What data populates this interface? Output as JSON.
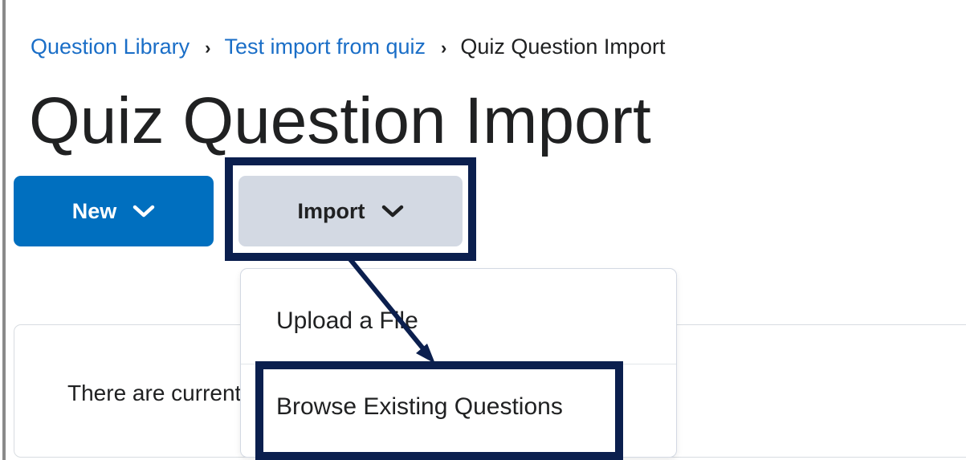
{
  "breadcrumb": {
    "items": [
      {
        "label": "Question Library"
      },
      {
        "label": "Test import from quiz"
      }
    ],
    "current": "Quiz Question Import",
    "separator": "›"
  },
  "page": {
    "title": "Quiz Question Import"
  },
  "toolbar": {
    "new_label": "New",
    "import_label": "Import"
  },
  "import_menu": {
    "items": [
      {
        "label": "Upload a File"
      },
      {
        "label": "Browse Existing Questions"
      }
    ]
  },
  "content": {
    "empty_message": "There are currently no questions defined in this section."
  },
  "colors": {
    "link": "#1a6ec7",
    "primary_button": "#006fbf",
    "secondary_button": "#d3d9e3",
    "annotation": "#0b1f4e",
    "text": "#202122"
  },
  "icons": {
    "dropdown": "chevron-down-icon",
    "breadcrumb_separator": "chevron-right-icon",
    "annotation_arrow": "arrow-icon"
  }
}
